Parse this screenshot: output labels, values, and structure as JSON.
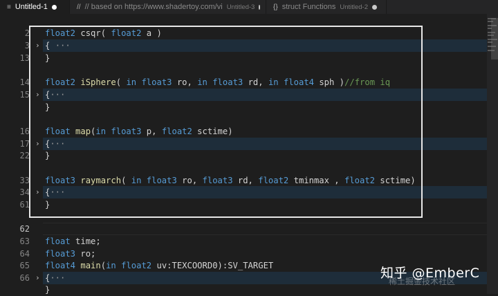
{
  "tabs": [
    {
      "icon": "≡",
      "title": "Untitled-1",
      "desc": "",
      "active": true
    },
    {
      "icon": "//",
      "title": "// based on https://www.shadertoy.com/vi",
      "desc": "Untitled-3",
      "active": false
    },
    {
      "icon": "{}",
      "title": "struct Functions",
      "desc": "Untitled-2",
      "active": false
    }
  ],
  "editor": {
    "line_numbers": [
      "2",
      "3",
      "13",
      "",
      "14",
      "15",
      "",
      "16",
      "17",
      "22",
      "",
      "33",
      "34",
      "61",
      "62",
      "63",
      "64",
      "65",
      "66",
      ""
    ],
    "current_line": "62"
  },
  "watermark": {
    "text": "知乎 @EmberC",
    "sub": "稀土掘金技术社区"
  },
  "colors": {
    "keyword_type": "#569cd6",
    "function": "#dcdcaa",
    "comment": "#6a9955",
    "fold_highlight": "#1e2d3a"
  }
}
